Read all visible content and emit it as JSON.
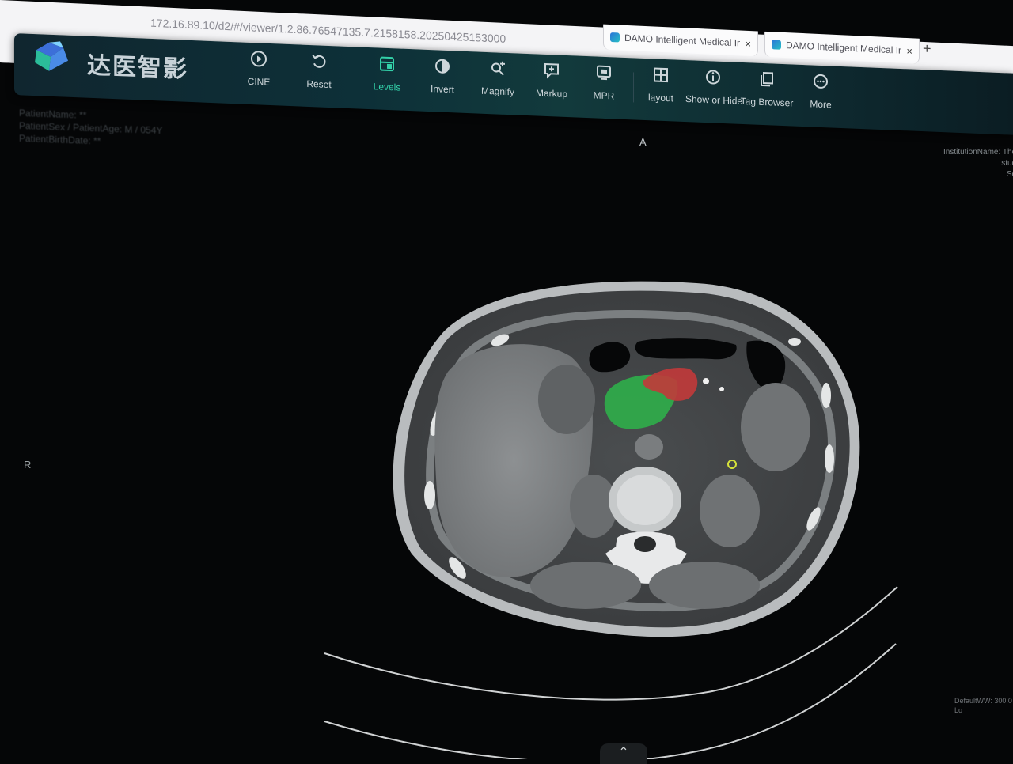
{
  "browser": {
    "url": "172.16.89.10/d2/#/viewer/1.2.86.76547135.7.2158158.20250425153000",
    "tabs": [
      {
        "title": "DAMO Intelligent Medical Ima",
        "close": "×"
      },
      {
        "title": "DAMO Intelligent Medical Ima",
        "close": "×"
      }
    ],
    "new_tab": "+"
  },
  "app": {
    "logo_text": "达医智影",
    "toolbar": [
      {
        "label": "CINE",
        "icon": "play-circle-icon"
      },
      {
        "label": "Reset",
        "icon": "reset-icon"
      },
      {
        "label": "Levels",
        "icon": "levels-icon",
        "active": true
      },
      {
        "label": "Invert",
        "icon": "invert-icon"
      },
      {
        "label": "Magnify",
        "icon": "magnify-icon"
      },
      {
        "label": "Markup",
        "icon": "markup-icon"
      },
      {
        "label": "MPR",
        "icon": "mpr-icon"
      },
      {
        "label": "layout",
        "icon": "layout-icon"
      },
      {
        "label": "Show or Hide",
        "icon": "info-icon"
      },
      {
        "label": "Tag Browser",
        "icon": "tag-browser-icon"
      },
      {
        "label": "More",
        "icon": "more-icon"
      }
    ],
    "accent_color": "#33d0a8"
  },
  "overlay": {
    "patient_lines": [
      "PatientName: **",
      "PatientSex / PatientAge: M / 054Y",
      "PatientBirthDate: **"
    ],
    "orientation_top": "A",
    "orientation_left": "R",
    "institution_lines": [
      "InstitutionName: The",
      "stud",
      "Se"
    ],
    "window_lines": [
      "DefaultWW: 300.0",
      "Lo"
    ]
  },
  "segmentation": {
    "region_1_color": "#2fae4a",
    "region_2_color": "#c23a3a",
    "marker_color": "#d6e23a"
  },
  "expand_button_icon": "chevron-up-icon",
  "expand_button_glyph": "⌃"
}
